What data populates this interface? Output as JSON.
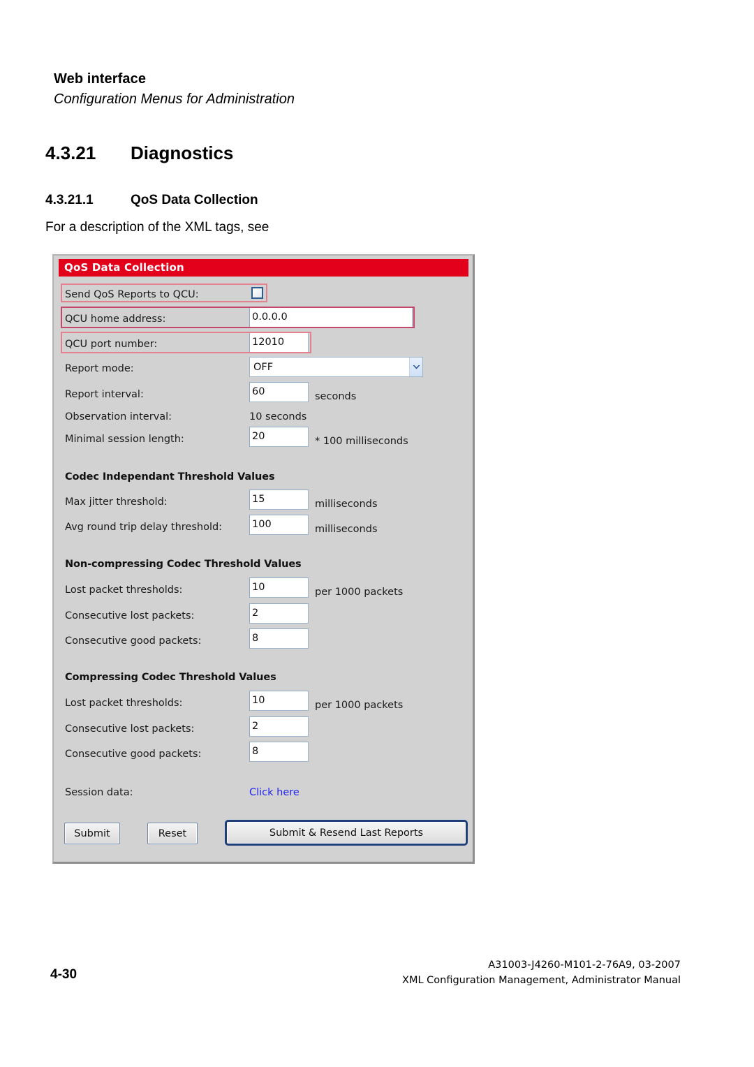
{
  "page_header": {
    "title": "Web interface",
    "subtitle": "Configuration Menus for Administration"
  },
  "sections": {
    "h1_number": "4.3.21",
    "h1_title": "Diagnostics",
    "h2_number": "4.3.21.1",
    "h2_title": "QoS Data Collection",
    "paragraph": "For a description of the XML tags, see"
  },
  "panel": {
    "titlebar": "QoS Data Collection",
    "colors": {
      "titlebar_bg": "#e3001b",
      "panel_bg": "#d2d2d2",
      "link": "#2424ef",
      "annotation_red": "#e4808f",
      "input_border": "#9db4cd"
    },
    "rows": [
      {
        "label": "Send QoS Reports to QCU:",
        "type": "checkbox",
        "checked": false
      },
      {
        "label": "QCU home address:",
        "type": "text",
        "value": "0.0.0.0"
      },
      {
        "label": "QCU port number:",
        "type": "text",
        "value": "12010"
      },
      {
        "label": "Report mode:",
        "type": "select",
        "value": "OFF"
      },
      {
        "label": "Report interval:",
        "type": "text",
        "value": "60",
        "unit": "seconds"
      },
      {
        "label": "Observation interval:",
        "type": "static",
        "value": "10 seconds"
      },
      {
        "label": "Minimal session length:",
        "type": "text",
        "value": "20",
        "unit": "* 100 milliseconds"
      }
    ],
    "group_codec_independant": {
      "heading": "Codec Independant Threshold Values",
      "rows": [
        {
          "label": "Max jitter threshold:",
          "value": "15",
          "unit": "milliseconds"
        },
        {
          "label": "Avg round trip delay threshold:",
          "value": "100",
          "unit": "milliseconds"
        }
      ]
    },
    "group_non_compressing": {
      "heading": "Non-compressing Codec Threshold Values",
      "rows": [
        {
          "label": "Lost packet thresholds:",
          "value": "10",
          "unit": "per 1000 packets"
        },
        {
          "label": "Consecutive lost packets:",
          "value": "2",
          "unit": ""
        },
        {
          "label": "Consecutive good packets:",
          "value": "8",
          "unit": ""
        }
      ]
    },
    "group_compressing": {
      "heading": "Compressing Codec Threshold Values",
      "rows": [
        {
          "label": "Lost packet thresholds:",
          "value": "10",
          "unit": "per 1000 packets"
        },
        {
          "label": "Consecutive lost packets:",
          "value": "2",
          "unit": ""
        },
        {
          "label": "Consecutive good packets:",
          "value": "8",
          "unit": ""
        }
      ]
    },
    "session": {
      "label": "Session data:",
      "link_text": "Click here"
    },
    "buttons": {
      "submit": "Submit",
      "reset": "Reset",
      "submit_resend": "Submit & Resend Last Reports"
    }
  },
  "footer": {
    "page_number": "4-30",
    "doc_id": "A31003-J4260-M101-2-76A9, 03-2007",
    "doc_title": "XML Configuration Management, Administrator Manual"
  }
}
